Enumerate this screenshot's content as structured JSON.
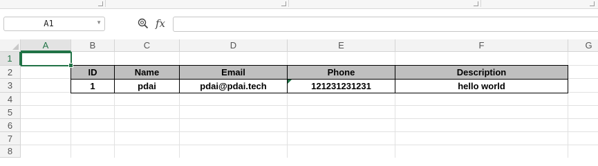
{
  "formula_bar": {
    "name_box": "A1",
    "formula": ""
  },
  "columns": [
    "A",
    "B",
    "C",
    "D",
    "E",
    "F",
    "G"
  ],
  "rows": [
    "1",
    "2",
    "3",
    "4",
    "5",
    "6",
    "7",
    "8"
  ],
  "table": {
    "headers": [
      "ID",
      "Name",
      "Email",
      "Phone",
      "Description"
    ],
    "rows": [
      [
        "1",
        "pdai",
        "pdai@pdai.tech",
        "121231231231",
        "hello world"
      ]
    ]
  },
  "colors": {
    "accent": "#217346",
    "header_fill": "#bfbfbf"
  }
}
